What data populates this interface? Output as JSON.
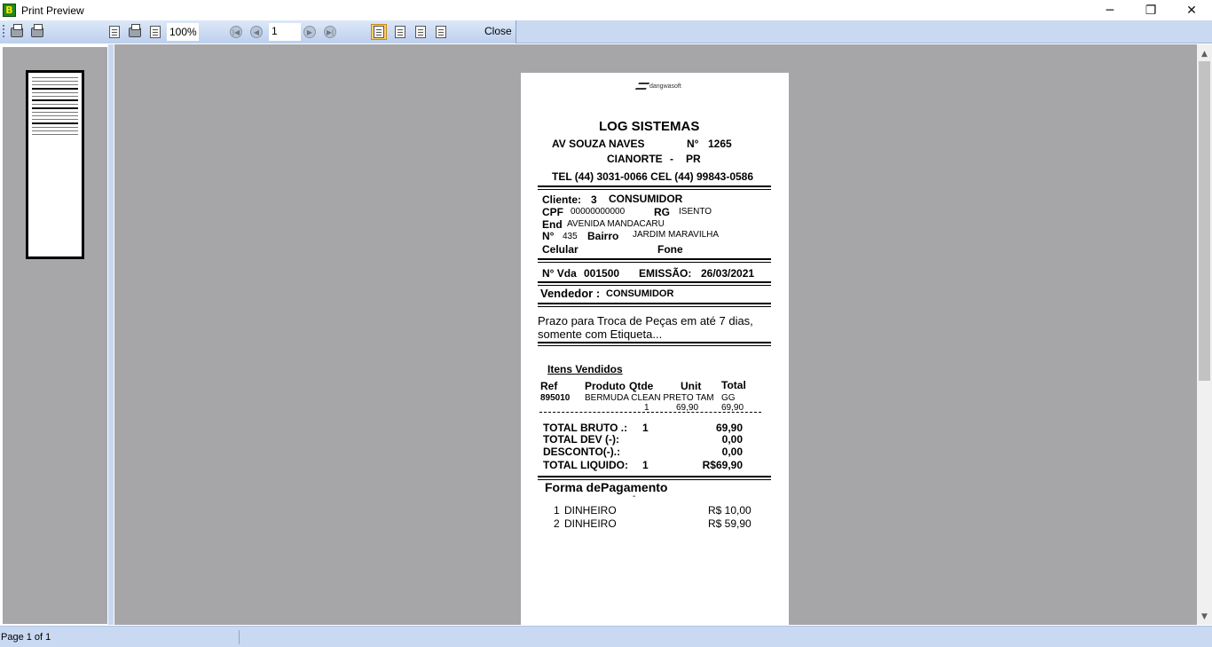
{
  "window": {
    "title": "Print Preview",
    "minimize": "─",
    "restore": "❐",
    "close": "✕"
  },
  "toolbar": {
    "zoom": "100%",
    "page_number": "1",
    "close_label": "Close"
  },
  "status": {
    "text": "Page 1 of 1"
  },
  "receipt": {
    "logo_text": "dangwasoft",
    "company": "LOG SISTEMAS",
    "address": "AV SOUZA NAVES",
    "number_label": "N°",
    "number": "1265",
    "city": "CIANORTE",
    "city_sep": "-",
    "state": "PR",
    "phones": "TEL (44) 3031-0066  CEL (44) 99843-0586",
    "client_label": "Cliente:",
    "client_id": "3",
    "client_name": "CONSUMIDOR",
    "cpf_label": "CPF",
    "cpf": "00000000000",
    "rg_label": "RG",
    "rg": "ISENTO",
    "end_label": "End",
    "end": "AVENIDA MANDACARU",
    "num_label": "N°",
    "num": "435",
    "bairro_label": "Bairro",
    "bairro": "JARDIM MARAVILHA",
    "celular_label": "Celular",
    "fone_label": "Fone",
    "vda_label": "N° Vda",
    "vda": "001500",
    "emissao_label": "EMISSÃO:",
    "emissao": "26/03/2021",
    "vendedor_label": "Vendedor :",
    "vendedor": "CONSUMIDOR",
    "note_line1": "Prazo para Troca de Peças em até 7 dias,",
    "note_line2": "somente com Etiqueta...",
    "items_title": "Itens Vendidos",
    "col_ref": "Ref",
    "col_produto": "Produto",
    "col_qtde": "Qtde",
    "col_unit": "Unit",
    "col_total": "Total",
    "item": {
      "ref": "895010",
      "produto": "BERMUDA CLEAN PRETO TAM",
      "tam": "GG",
      "qtde": "1",
      "unit": "69,90",
      "total": "69,90"
    },
    "totals": {
      "bruto_label": "TOTAL BRUTO .:",
      "bruto_qtde": "1",
      "bruto": "69,90",
      "dev_label": "TOTAL DEV (-):",
      "dev": "0,00",
      "desc_label": "DESCONTO(-).:",
      "desc": "0,00",
      "liquido_label": "TOTAL LIQUIDO:",
      "liquido_qtde": "1",
      "liquido": "R$69,90"
    },
    "payment_title": "Forma dePagamento",
    "payment_dash": "-",
    "payments": [
      {
        "n": "1",
        "method": "DINHEIRO",
        "value": "R$ 10,00"
      },
      {
        "n": "2",
        "method": "DINHEIRO",
        "value": "R$ 59,90"
      }
    ]
  }
}
